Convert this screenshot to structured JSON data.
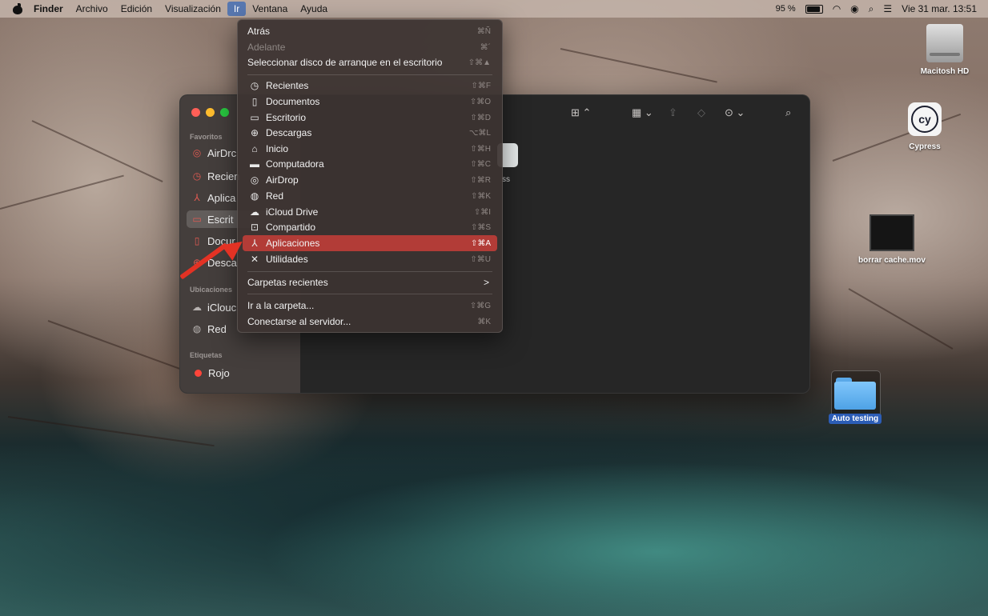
{
  "menubar": {
    "app_name": "Finder",
    "items": [
      "Archivo",
      "Edición",
      "Visualización",
      "Ir",
      "Ventana",
      "Ayuda"
    ],
    "battery_text": "95 %",
    "datetime": "Vie 31 mar. 13:51"
  },
  "go_menu": {
    "items": [
      {
        "label": "Atrás",
        "shortcut": "⌘Ñ",
        "icon": ""
      },
      {
        "label": "Adelante",
        "shortcut": "⌘´",
        "icon": "",
        "disabled": true
      },
      {
        "label": "Seleccionar disco de arranque en el escritorio",
        "shortcut": "⇧⌘▲",
        "icon": ""
      },
      {
        "label": "Recientes",
        "shortcut": "⇧⌘F",
        "icon": "clock-icon"
      },
      {
        "label": "Documentos",
        "shortcut": "⇧⌘O",
        "icon": "document-icon"
      },
      {
        "label": "Escritorio",
        "shortcut": "⇧⌘D",
        "icon": "desktop-icon"
      },
      {
        "label": "Descargas",
        "shortcut": "⌥⌘L",
        "icon": "download-icon"
      },
      {
        "label": "Inicio",
        "shortcut": "⇧⌘H",
        "icon": "home-icon"
      },
      {
        "label": "Computadora",
        "shortcut": "⇧⌘C",
        "icon": "computer-icon"
      },
      {
        "label": "AirDrop",
        "shortcut": "⇧⌘R",
        "icon": "airdrop-icon"
      },
      {
        "label": "Red",
        "shortcut": "⇧⌘K",
        "icon": "network-icon"
      },
      {
        "label": "iCloud Drive",
        "shortcut": "⇧⌘I",
        "icon": "cloud-icon"
      },
      {
        "label": "Compartido",
        "shortcut": "⇧⌘S",
        "icon": "shared-folder-icon"
      },
      {
        "label": "Aplicaciones",
        "shortcut": "⇧⌘A",
        "icon": "applications-icon",
        "highlighted": true
      },
      {
        "label": "Utilidades",
        "shortcut": "⇧⌘U",
        "icon": "utilities-icon"
      },
      {
        "label": "Carpetas recientes",
        "shortcut": ">",
        "icon": ""
      },
      {
        "label": "Ir a la carpeta...",
        "shortcut": "⇧⌘G",
        "icon": ""
      },
      {
        "label": "Conectarse al servidor...",
        "shortcut": "⌘K",
        "icon": ""
      }
    ]
  },
  "finder": {
    "sidebar": {
      "favorites_title": "Favoritos",
      "favorites": [
        {
          "label": "AirDrc",
          "icon": "airdrop-icon"
        },
        {
          "label": "Recien",
          "icon": "clock-icon"
        },
        {
          "label": "Aplica",
          "icon": "applications-icon"
        },
        {
          "label": "Escrit",
          "icon": "desktop-icon",
          "selected": true
        },
        {
          "label": "Docur",
          "icon": "document-icon"
        },
        {
          "label": "Desca",
          "icon": "download-icon"
        }
      ],
      "locations_title": "Ubicaciones",
      "locations": [
        {
          "label": "iClouc",
          "icon": "cloud-icon"
        },
        {
          "label": "Red",
          "icon": "network-icon"
        }
      ],
      "tags_title": "Etiquetas",
      "tags": [
        {
          "label": "Rojo",
          "color": "#ff453a"
        }
      ]
    },
    "content_partial_label": "ss"
  },
  "desktop_icons": [
    {
      "label": "Macitosh HD",
      "icon": "hard-drive-icon"
    },
    {
      "label": "Cypress",
      "icon": "cypress-app-icon"
    },
    {
      "label": "borrar cache.mov",
      "icon": "video-file-icon"
    },
    {
      "label": "Auto testing",
      "icon": "folder-icon"
    }
  ],
  "colors": {
    "menu_highlight": "#b23c37",
    "annotation_arrow": "#e33224",
    "tag_red": "#ff453a"
  }
}
